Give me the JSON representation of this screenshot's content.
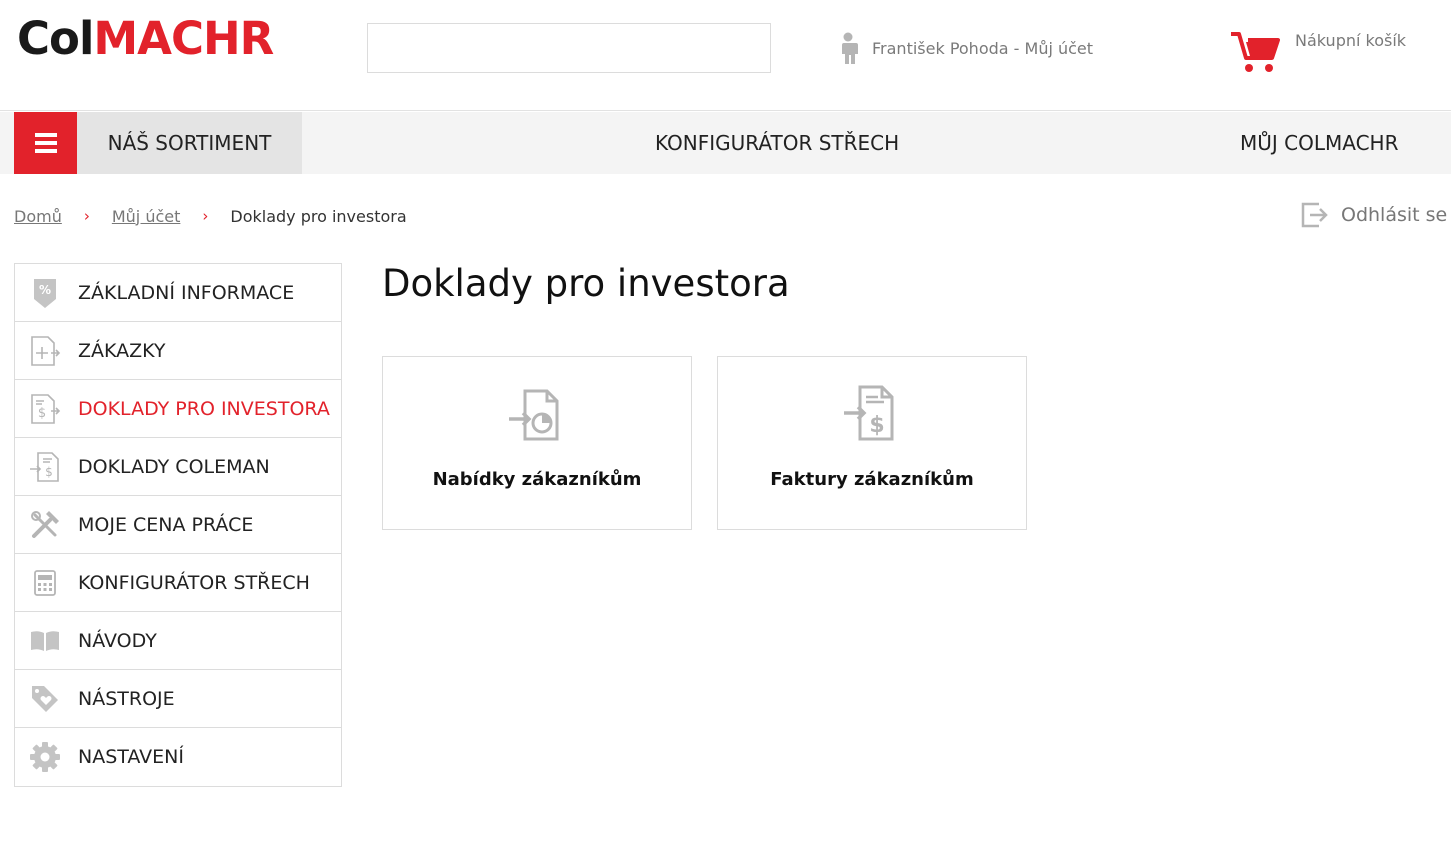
{
  "header": {
    "logo_part1": "Col",
    "logo_part2": "MACHR",
    "search_value": "",
    "account_label": "František Pohoda - Můj účet",
    "cart_label": "Nákupní košík"
  },
  "nav": {
    "sortiment": "NÁŠ SORTIMENT",
    "konfigurator": "KONFIGURÁTOR STŘECH",
    "muj": "MŮJ COLMACHR"
  },
  "breadcrumb": {
    "home": "Domů",
    "account": "Můj účet",
    "current": "Doklady pro investora",
    "separator": "›"
  },
  "logout_label": "Odhlásit se",
  "sidebar": {
    "items": [
      {
        "label": "ZÁKLADNÍ INFORMACE",
        "icon": "percent-tag-icon"
      },
      {
        "label": "ZÁKAZKY",
        "icon": "add-document-icon"
      },
      {
        "label": "DOKLADY PRO INVESTORA",
        "icon": "dollar-document-arrow-icon",
        "active": true
      },
      {
        "label": "DOKLADY COLEMAN",
        "icon": "arrow-dollar-document-icon"
      },
      {
        "label": "MOJE CENA PRÁCE",
        "icon": "tools-icon"
      },
      {
        "label": "KONFIGURÁTOR STŘECH",
        "icon": "calculator-icon"
      },
      {
        "label": "NÁVODY",
        "icon": "book-icon"
      },
      {
        "label": "NÁSTROJE",
        "icon": "tag-heart-icon"
      },
      {
        "label": "NASTAVENÍ",
        "icon": "gear-icon"
      }
    ]
  },
  "main": {
    "title": "Doklady pro investora",
    "cards": [
      {
        "label": "Nabídky zákazníkům",
        "icon": "offer-document-icon"
      },
      {
        "label": "Faktury zákazníkům",
        "icon": "invoice-document-icon"
      }
    ]
  },
  "colors": {
    "accent": "#e2222b",
    "icon_gray": "#b5b5b5",
    "nav_bg": "#f4f4f4"
  }
}
